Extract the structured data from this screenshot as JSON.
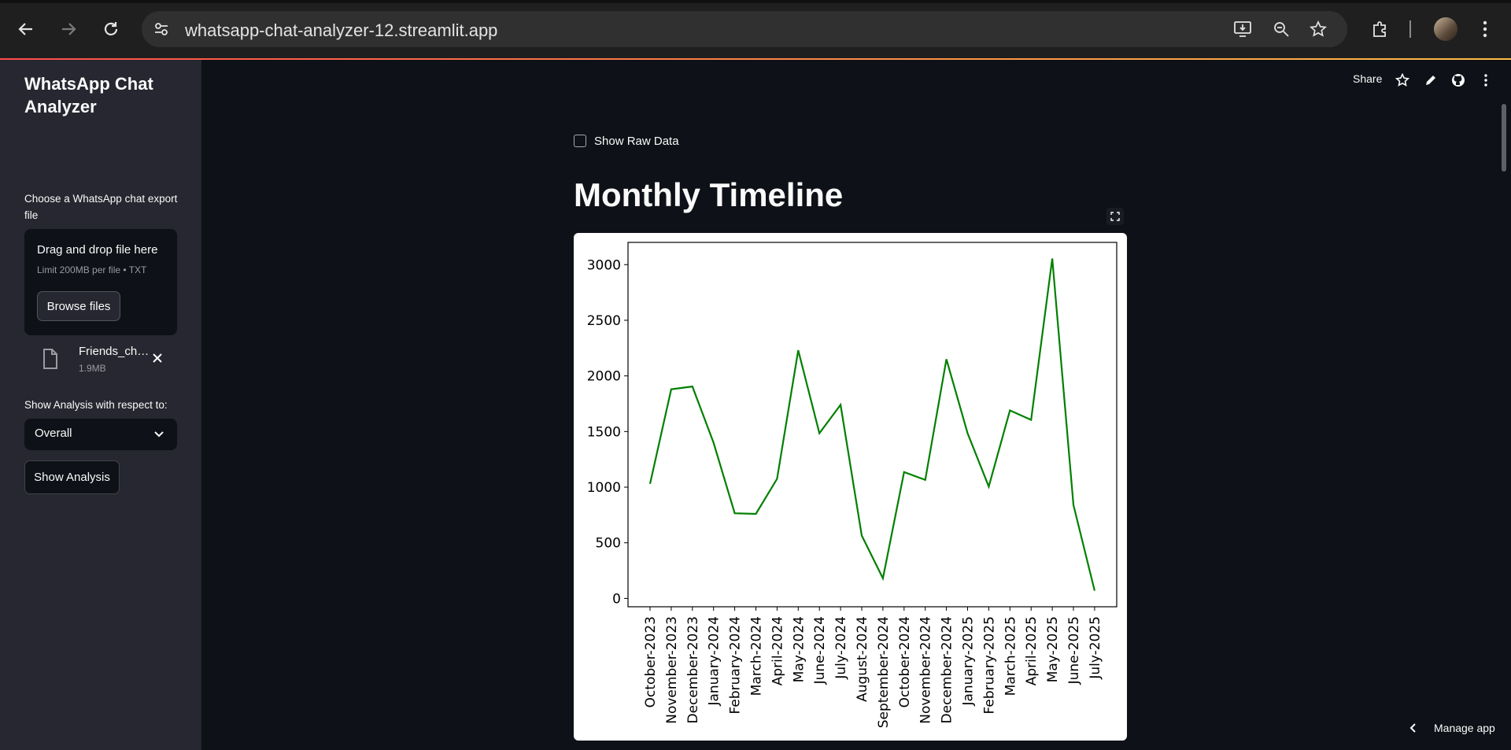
{
  "browser": {
    "url": "whatsapp-chat-analyzer-12.streamlit.app"
  },
  "header": {
    "share_label": "Share"
  },
  "sidebar": {
    "title": "WhatsApp Chat Analyzer",
    "uploader_label": "Choose a WhatsApp chat export file",
    "dropzone_text": "Drag and drop file here",
    "limit_text": "Limit 200MB per file • TXT",
    "browse_label": "Browse files",
    "file_name": "Friends_ch…",
    "file_size": "1.9MB",
    "select_label": "Show Analysis with respect to:",
    "select_value": "Overall",
    "analyze_label": "Show Analysis"
  },
  "main": {
    "checkbox_label": "Show Raw Data",
    "title": "Monthly Timeline"
  },
  "footer": {
    "manage_label": "Manage app"
  },
  "colors": {
    "accent_line": "#008000",
    "bg": "#0e1117",
    "sidebar": "#262730"
  },
  "chart_data": {
    "type": "line",
    "title": "",
    "xlabel": "",
    "ylabel": "",
    "ylim": [
      -75,
      3200
    ],
    "yticks": [
      0,
      500,
      1000,
      1500,
      2000,
      2500,
      3000
    ],
    "categories": [
      "October-2023",
      "November-2023",
      "December-2023",
      "January-2024",
      "February-2024",
      "March-2024",
      "April-2024",
      "May-2024",
      "June-2024",
      "July-2024",
      "August-2024",
      "September-2024",
      "October-2024",
      "November-2024",
      "December-2024",
      "January-2025",
      "February-2025",
      "March-2025",
      "April-2025",
      "May-2025",
      "June-2025",
      "July-2025"
    ],
    "series": [
      {
        "values": [
          1030,
          1880,
          1905,
          1400,
          765,
          760,
          1075,
          2230,
          1485,
          1740,
          565,
          180,
          1135,
          1065,
          2150,
          1485,
          1005,
          1690,
          1605,
          3055,
          840,
          70
        ],
        "color": "#008000"
      }
    ]
  }
}
